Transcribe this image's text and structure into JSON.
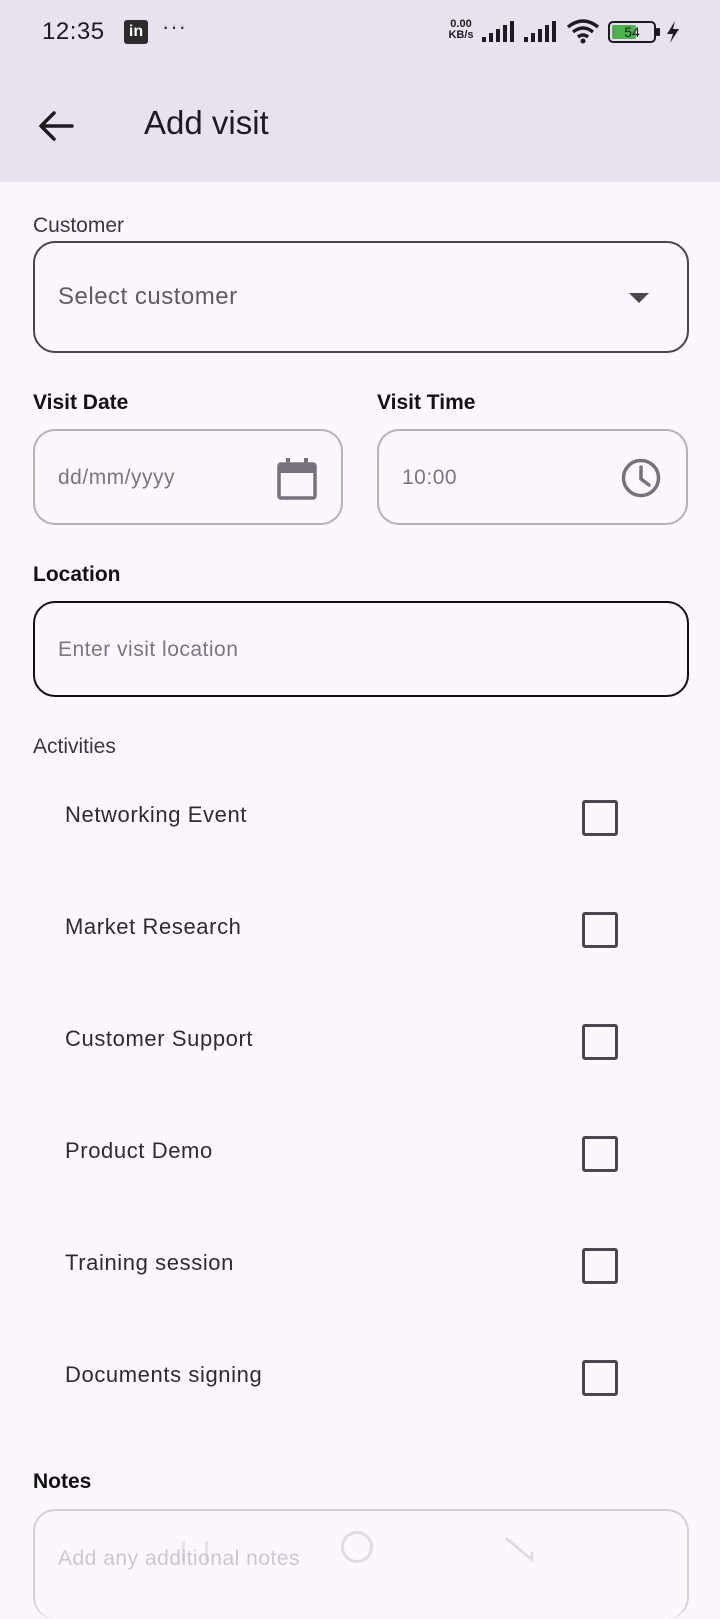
{
  "status_bar": {
    "time": "12:35",
    "app_icon": "in",
    "more": "···",
    "speed_value": "0.00",
    "speed_unit": "KB/s",
    "battery": "54",
    "battery_color": "#4caf50"
  },
  "app_bar": {
    "title": "Add visit"
  },
  "form": {
    "customer_label": "Customer",
    "customer_placeholder": "Select customer",
    "visit_date_label": "Visit Date",
    "visit_date_placeholder": "dd/mm/yyyy",
    "visit_time_label": "Visit Time",
    "visit_time_value": "10:00",
    "location_label": "Location",
    "location_placeholder": "Enter visit location",
    "activities_label": "Activities",
    "activities": [
      {
        "label": "Networking Event",
        "checked": false
      },
      {
        "label": "Market Research",
        "checked": false
      },
      {
        "label": "Customer Support",
        "checked": false
      },
      {
        "label": "Product Demo",
        "checked": false
      },
      {
        "label": "Training session",
        "checked": false
      },
      {
        "label": "Documents signing",
        "checked": false
      }
    ],
    "notes_label": "Notes",
    "notes_placeholder": "Add any additional notes"
  },
  "colors": {
    "app_bar_bg": "#e8e2ee",
    "page_bg": "#fcf7fc",
    "outline": "#4a4550"
  }
}
